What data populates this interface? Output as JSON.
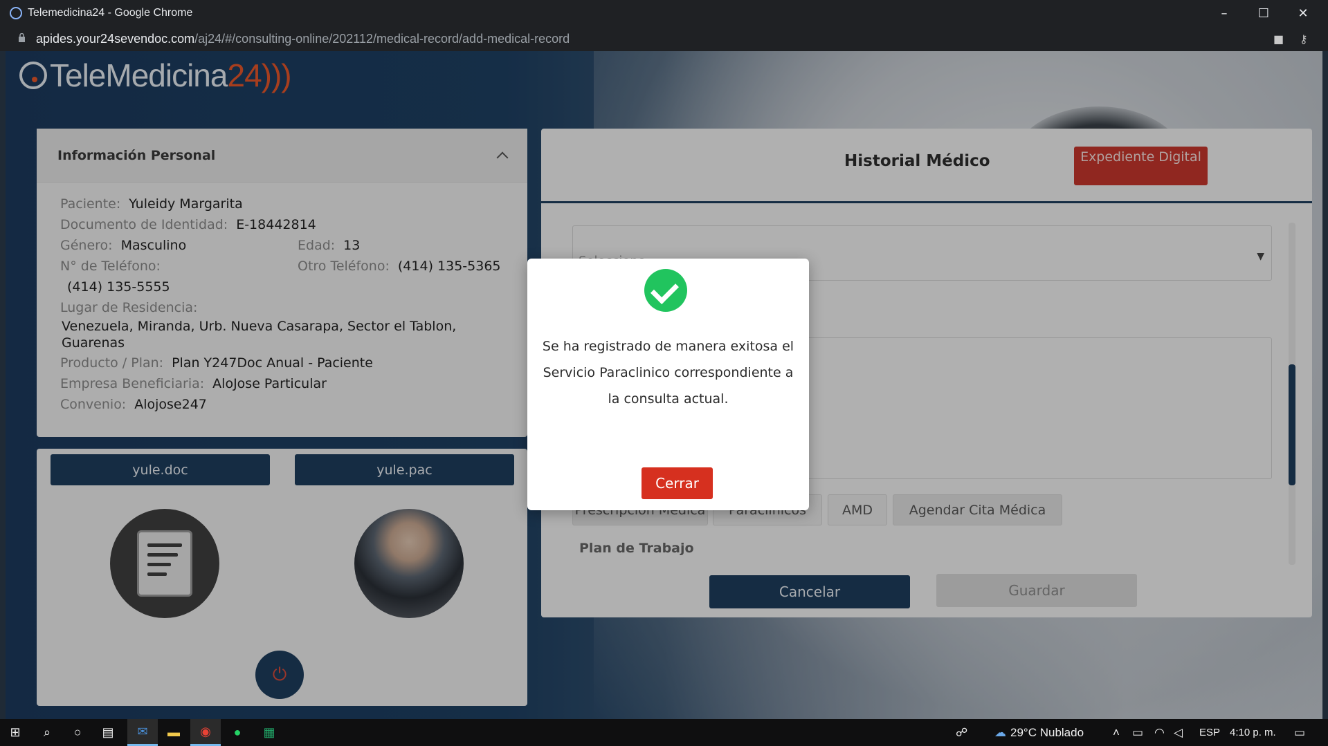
{
  "window": {
    "title": "Telemedicina24 - Google Chrome",
    "url_host": "apides.your24sevendoc.com",
    "url_path": "/aj24/#/consulting-online/202112/medical-record/add-medical-record"
  },
  "logo": {
    "text": "TeleMedicina",
    "num": "24"
  },
  "personal_info": {
    "title": "Información Personal",
    "patient_label": "Paciente:",
    "patient_value": "Yuleidy Margarita",
    "id_label": "Documento de Identidad:",
    "id_value": "E-18442814",
    "gender_label": "Género:",
    "gender_value": "Masculino",
    "age_label": "Edad:",
    "age_value": "13",
    "phone_label": "N° de Teléfono:",
    "phone_value": "(414) 135-5555",
    "other_phone_label": "Otro Teléfono:",
    "other_phone_value": "(414) 135-5365",
    "residence_label": "Lugar de Residencia:",
    "residence_value_1": "Venezuela, Miranda, Urb. Nueva Casarapa, Sector el Tablon,",
    "residence_value_2": "Guarenas",
    "plan_label": "Producto / Plan:",
    "plan_value": "Plan Y247Doc Anual - Paciente",
    "company_label": "Empresa Beneficiaria:",
    "company_value": "AloJose Particular",
    "agreement_label": "Convenio:",
    "agreement_value": "Alojose247"
  },
  "video": {
    "doctor_name": "yule.doc",
    "patient_name": "yule.pac"
  },
  "history": {
    "title": "Historial Médico",
    "expediente_label": "Expediente Digital",
    "select_placeholder": "Seleccione",
    "tabs": [
      "Prescripción Médica",
      "Paraclínicos",
      "AMD",
      "Agendar Cita Médica"
    ],
    "plan_label": "Plan de Trabajo",
    "cancel_label": "Cancelar",
    "save_label": "Guardar"
  },
  "modal": {
    "message": "Se ha registrado de manera exitosa el Servicio Paraclinico correspondiente a la consulta actual.",
    "close_label": "Cerrar"
  },
  "taskbar": {
    "weather": "29°C  Nublado",
    "lang": "ESP",
    "time": "4:10 p. m."
  }
}
